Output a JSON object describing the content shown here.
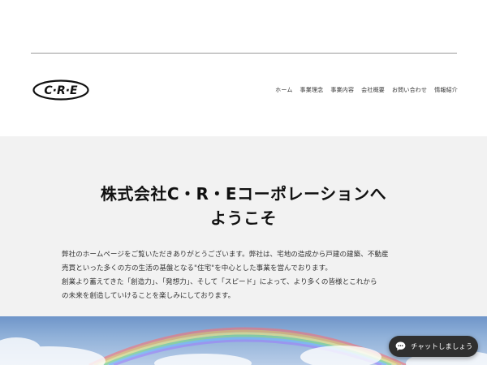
{
  "header": {
    "logo_text": "C·R·E",
    "nav": [
      {
        "label": "ホーム"
      },
      {
        "label": "事業理念"
      },
      {
        "label": "事業内容"
      },
      {
        "label": "会社概要"
      },
      {
        "label": "お問い合わせ"
      },
      {
        "label": "情報紹介"
      }
    ]
  },
  "hero": {
    "title_line1": "株式会社C・R・Eコーポレーションへ",
    "title_line2": "ようこそ",
    "body_lines": [
      "弊社のホームページをご覧いただきありがとうございます。弊社は、宅地の造成から戸建の建築、不動産",
      "売買といった多くの方の生活の基盤となる\"住宅\"を中心とした事業を営んでおります。",
      "創業より蓄えてきた「創造力」、「発想力」、そして「スピード」によって、より多くの皆様とこれから",
      "の未来を創造していけることを楽しみにしております。"
    ]
  },
  "chat": {
    "label": "チャットしましょう",
    "icon": "chat-bubble-icon"
  },
  "colors": {
    "hero_bg": "#f2f2f2",
    "chat_bg": "#2f2f2f",
    "rule": "#9a9a9a"
  }
}
